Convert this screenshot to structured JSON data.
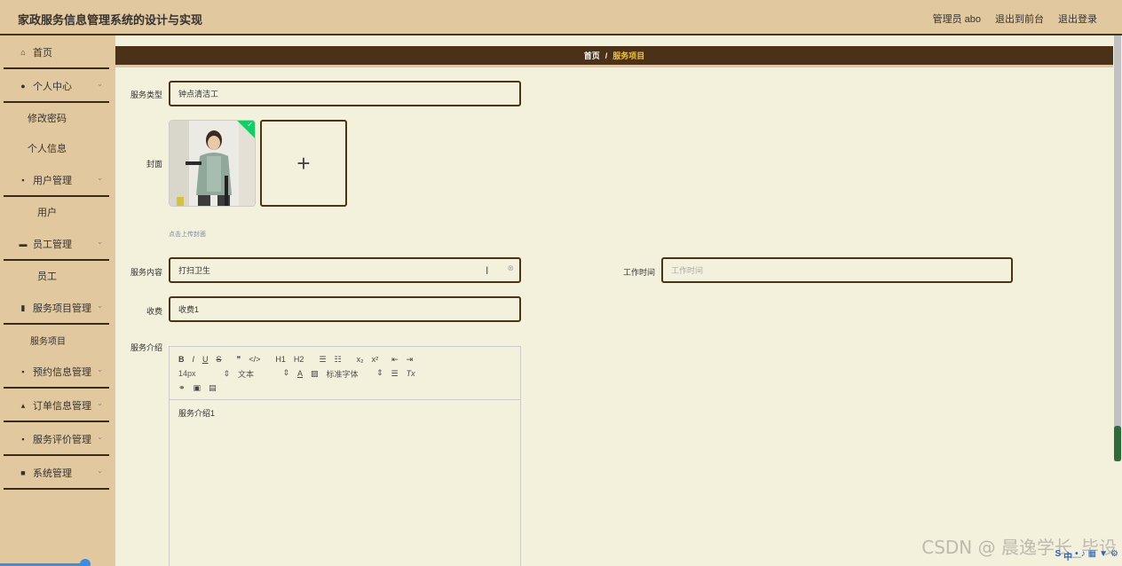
{
  "header": {
    "title": "家政服务信息管理系统的设计与实现",
    "admin_label": "管理员 abo",
    "front_label": "退出到前台",
    "logout_label": "退出登录"
  },
  "sidebar": {
    "items": [
      {
        "label": "首页",
        "icon": "home-icon",
        "glyph": "⌂"
      },
      {
        "label": "个人中心",
        "icon": "user-icon",
        "glyph": "●"
      },
      {
        "label": "修改密码"
      },
      {
        "label": "个人信息"
      },
      {
        "label": "用户管理",
        "icon": "grid-icon",
        "glyph": "▪"
      },
      {
        "label": "用户"
      },
      {
        "label": "员工管理",
        "icon": "ticket-icon",
        "glyph": "▬"
      },
      {
        "label": "员工"
      },
      {
        "label": "服务项目管理",
        "icon": "bar-chart-icon",
        "glyph": "▮"
      },
      {
        "label": "服务项目"
      },
      {
        "label": "预约信息管理",
        "icon": "grid-icon",
        "glyph": "▪"
      },
      {
        "label": "订单信息管理",
        "icon": "thumb-icon",
        "glyph": "▴"
      },
      {
        "label": "服务评价管理",
        "icon": "grid-icon",
        "glyph": "▪"
      },
      {
        "label": "系统管理",
        "icon": "clipboard-icon",
        "glyph": "■"
      }
    ]
  },
  "breadcrumb": {
    "home": "首页",
    "separator": "/",
    "current": "服务项目"
  },
  "form": {
    "service_type_label": "服务类型",
    "service_type_value": "钟点清洁工",
    "cover_label": "封面",
    "upload_plus": "+",
    "upload_hint": "点击上传封面",
    "service_content_label": "服务内容",
    "service_content_value": "打扫卫生",
    "work_time_label": "工作时间",
    "work_time_placeholder": "工作时间",
    "fee_label": "收费",
    "fee_value": "收费1",
    "intro_label": "服务介绍",
    "intro_value": "服务介绍1"
  },
  "editor_toolbar": {
    "row1": [
      "B",
      "I",
      "U",
      "S",
      "❞",
      "</>",
      "H1",
      "H2",
      "☰",
      "☷",
      "x₂",
      "x²",
      "⇤",
      "⇥"
    ],
    "font_size": "14px",
    "text_style": "文本",
    "font_color": "A",
    "font_family": "标准字体",
    "clear_format": "Tx"
  },
  "watermark": "CSDN @ 晨逸学长_毕设"
}
